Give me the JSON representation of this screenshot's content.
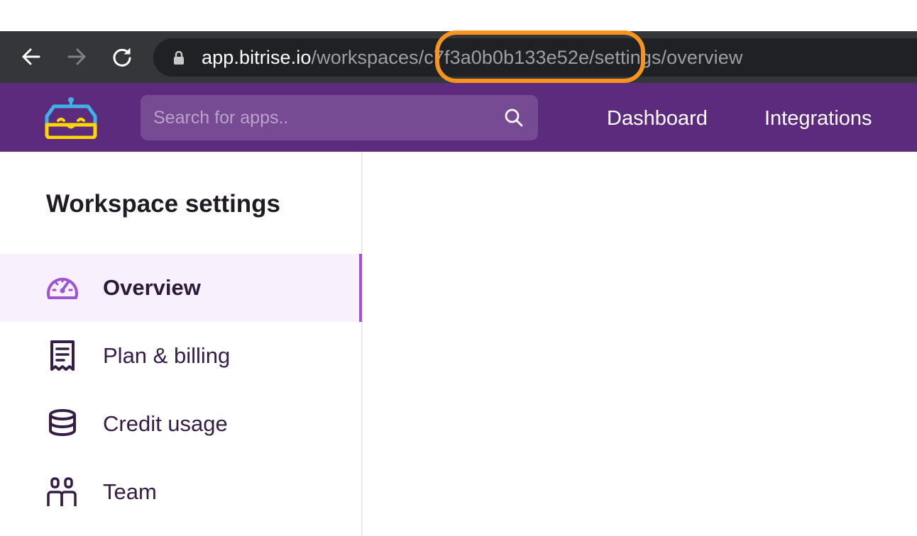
{
  "browser": {
    "url_host": "app.bitrise.io",
    "url_path": "/workspaces/c7f3a0b0b133e52e/settings/overview"
  },
  "header": {
    "search_placeholder": "Search for apps..",
    "nav": [
      "Dashboard",
      "Integrations"
    ]
  },
  "sidebar": {
    "title": "Workspace settings",
    "items": [
      {
        "label": "Overview",
        "icon": "gauge-icon",
        "active": true
      },
      {
        "label": "Plan & billing",
        "icon": "receipt-icon",
        "active": false
      },
      {
        "label": "Credit usage",
        "icon": "coin-stack-icon",
        "active": false
      },
      {
        "label": "Team",
        "icon": "team-icon",
        "active": false
      }
    ]
  },
  "colors": {
    "header_bg": "#5c2b7d",
    "accent": "#9d55d3",
    "highlight": "#f7941d"
  }
}
